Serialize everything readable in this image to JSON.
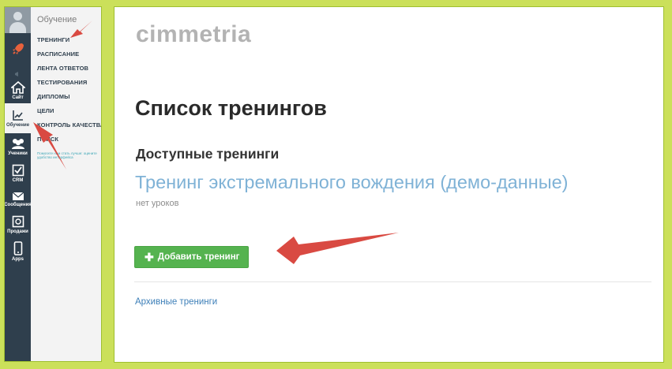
{
  "sidebar": {
    "rail": [
      {
        "label": "",
        "icon": "rocket-icon"
      },
      {
        "label": "",
        "icon": "megaphone-icon"
      },
      {
        "label": "Сайт",
        "icon": "home-icon"
      },
      {
        "label": "Обучение",
        "icon": "chart-icon"
      },
      {
        "label": "Ученики",
        "icon": "users-icon"
      },
      {
        "label": "CRM",
        "icon": "checkbox-icon"
      },
      {
        "label": "Сообщения",
        "icon": "envelope-icon"
      },
      {
        "label": "Продажи",
        "icon": "safe-icon"
      },
      {
        "label": "Apps",
        "icon": "phone-icon"
      }
    ],
    "menu_title": "Обучение",
    "menu_items": [
      "ТРЕНИНГИ",
      "РАСПИСАНИЕ",
      "ЛЕНТА ОТВЕТОВ",
      "ТЕСТИРОВАНИЯ",
      "ДИПЛОМЫ",
      "ЦЕЛИ",
      "КОНТРОЛЬ КАЧЕСТВА",
      "ПОИСК"
    ],
    "hint": "Помогите нам стать лучше: оцените удобство интерфейса"
  },
  "main": {
    "logo": "cimmetria",
    "page_title": "Список тренингов",
    "section_title": "Доступные тренинги",
    "training_link": "Тренинг экстремального вождения (демо-данные)",
    "lessons_text": "нет уроков",
    "add_button_label": "Добавить тренинг",
    "archive_link": "Архивные тренинги"
  },
  "colors": {
    "background": "#cbe05a",
    "rail": "#2f3f4d",
    "button": "#55b34f",
    "link": "#7fb2d6",
    "arrow": "#d94a42"
  }
}
